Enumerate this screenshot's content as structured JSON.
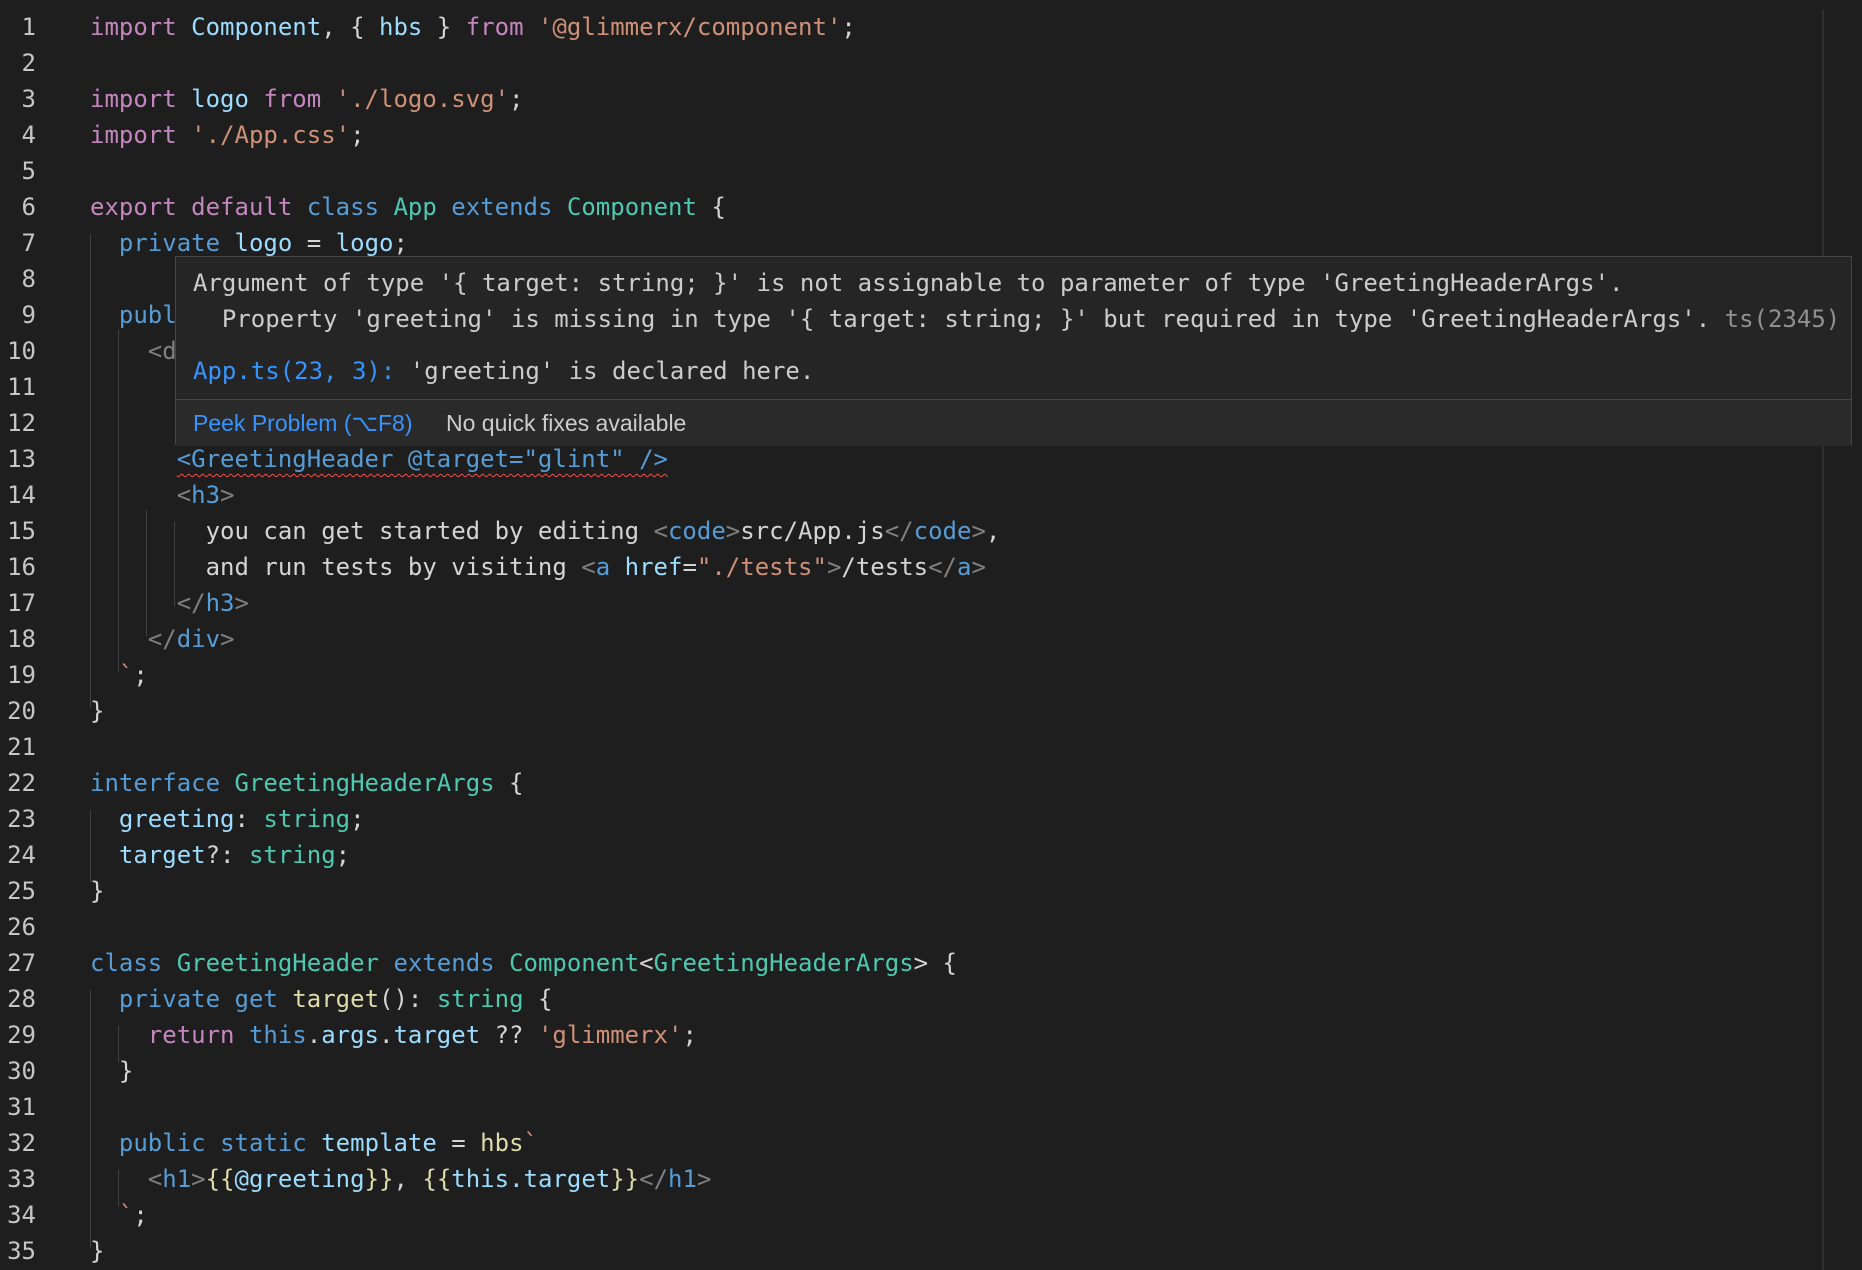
{
  "editor": {
    "line_numbers": [
      "1",
      "2",
      "3",
      "4",
      "5",
      "6",
      "7",
      "8",
      "9",
      "10",
      "11",
      "12",
      "13",
      "14",
      "15",
      "16",
      "17",
      "18",
      "19",
      "20",
      "21",
      "22",
      "23",
      "24",
      "25",
      "26",
      "27",
      "28",
      "29",
      "30",
      "31",
      "32",
      "33",
      "34",
      "35"
    ],
    "lines": [
      [
        [
          "k",
          "import"
        ],
        [
          "p",
          " "
        ],
        [
          "v",
          "Component"
        ],
        [
          "p",
          ", { "
        ],
        [
          "v",
          "hbs"
        ],
        [
          "p",
          " } "
        ],
        [
          "k",
          "from"
        ],
        [
          "p",
          " "
        ],
        [
          "s",
          "'@glimmerx/component'"
        ],
        [
          "p",
          ";"
        ]
      ],
      [],
      [
        [
          "k",
          "import"
        ],
        [
          "p",
          " "
        ],
        [
          "v",
          "logo"
        ],
        [
          "p",
          " "
        ],
        [
          "k",
          "from"
        ],
        [
          "p",
          " "
        ],
        [
          "s",
          "'./logo.svg'"
        ],
        [
          "p",
          ";"
        ]
      ],
      [
        [
          "k",
          "import"
        ],
        [
          "p",
          " "
        ],
        [
          "s",
          "'./App.css'"
        ],
        [
          "p",
          ";"
        ]
      ],
      [],
      [
        [
          "k",
          "export"
        ],
        [
          "p",
          " "
        ],
        [
          "k",
          "default"
        ],
        [
          "p",
          " "
        ],
        [
          "b",
          "class"
        ],
        [
          "p",
          " "
        ],
        [
          "t",
          "App"
        ],
        [
          "p",
          " "
        ],
        [
          "b",
          "extends"
        ],
        [
          "p",
          " "
        ],
        [
          "t",
          "Component"
        ],
        [
          "p",
          " {"
        ]
      ],
      [
        [
          "p",
          "  "
        ],
        [
          "b",
          "private"
        ],
        [
          "p",
          " "
        ],
        [
          "v",
          "logo"
        ],
        [
          "p",
          " = "
        ],
        [
          "v",
          "logo"
        ],
        [
          "p",
          ";"
        ]
      ],
      [],
      [
        [
          "p",
          "  "
        ],
        [
          "b",
          "publ"
        ]
      ],
      [
        [
          "p",
          "    "
        ],
        [
          "g",
          "<d"
        ]
      ],
      [],
      [],
      [
        [
          "p",
          "      "
        ],
        [
          "sq",
          "<GreetingHeader @target=\"glint\" />"
        ]
      ],
      [
        [
          "p",
          "      "
        ],
        [
          "g",
          "<"
        ],
        [
          "b",
          "h3"
        ],
        [
          "g",
          ">"
        ]
      ],
      [
        [
          "p",
          "        you can get started by editing "
        ],
        [
          "g",
          "<"
        ],
        [
          "b",
          "code"
        ],
        [
          "g",
          ">"
        ],
        [
          "p",
          "src/App.js"
        ],
        [
          "g",
          "</"
        ],
        [
          "b",
          "code"
        ],
        [
          "g",
          ">"
        ],
        [
          "p",
          ","
        ]
      ],
      [
        [
          "p",
          "        and run tests by visiting "
        ],
        [
          "g",
          "<"
        ],
        [
          "b",
          "a"
        ],
        [
          "p",
          " "
        ],
        [
          "v",
          "href"
        ],
        [
          "p",
          "="
        ],
        [
          "s",
          "\"./tests\""
        ],
        [
          "g",
          ">"
        ],
        [
          "p",
          "/tests"
        ],
        [
          "g",
          "</"
        ],
        [
          "b",
          "a"
        ],
        [
          "g",
          ">"
        ]
      ],
      [
        [
          "p",
          "      "
        ],
        [
          "g",
          "</"
        ],
        [
          "b",
          "h3"
        ],
        [
          "g",
          ">"
        ]
      ],
      [
        [
          "p",
          "    "
        ],
        [
          "g",
          "</"
        ],
        [
          "b",
          "div"
        ],
        [
          "g",
          ">"
        ]
      ],
      [
        [
          "p",
          "  "
        ],
        [
          "s",
          "`"
        ],
        [
          "p",
          ";"
        ]
      ],
      [
        [
          "p",
          "}"
        ]
      ],
      [],
      [
        [
          "b",
          "interface"
        ],
        [
          "p",
          " "
        ],
        [
          "t",
          "GreetingHeaderArgs"
        ],
        [
          "p",
          " {"
        ]
      ],
      [
        [
          "p",
          "  "
        ],
        [
          "v",
          "greeting"
        ],
        [
          "p",
          ": "
        ],
        [
          "t",
          "string"
        ],
        [
          "p",
          ";"
        ]
      ],
      [
        [
          "p",
          "  "
        ],
        [
          "v",
          "target"
        ],
        [
          "p",
          "?: "
        ],
        [
          "t",
          "string"
        ],
        [
          "p",
          ";"
        ]
      ],
      [
        [
          "p",
          "}"
        ]
      ],
      [],
      [
        [
          "b",
          "class"
        ],
        [
          "p",
          " "
        ],
        [
          "t",
          "GreetingHeader"
        ],
        [
          "p",
          " "
        ],
        [
          "b",
          "extends"
        ],
        [
          "p",
          " "
        ],
        [
          "t",
          "Component"
        ],
        [
          "p",
          "<"
        ],
        [
          "t",
          "GreetingHeaderArgs"
        ],
        [
          "p",
          "> {"
        ]
      ],
      [
        [
          "p",
          "  "
        ],
        [
          "b",
          "private"
        ],
        [
          "p",
          " "
        ],
        [
          "b",
          "get"
        ],
        [
          "p",
          " "
        ],
        [
          "y",
          "target"
        ],
        [
          "p",
          "(): "
        ],
        [
          "t",
          "string"
        ],
        [
          "p",
          " {"
        ]
      ],
      [
        [
          "p",
          "    "
        ],
        [
          "k",
          "return"
        ],
        [
          "p",
          " "
        ],
        [
          "b",
          "this"
        ],
        [
          "p",
          "."
        ],
        [
          "v",
          "args"
        ],
        [
          "p",
          "."
        ],
        [
          "v",
          "target"
        ],
        [
          "p",
          " ?? "
        ],
        [
          "s",
          "'glimmerx'"
        ],
        [
          "p",
          ";"
        ]
      ],
      [
        [
          "p",
          "  }"
        ]
      ],
      [],
      [
        [
          "p",
          "  "
        ],
        [
          "b",
          "public"
        ],
        [
          "p",
          " "
        ],
        [
          "b",
          "static"
        ],
        [
          "p",
          " "
        ],
        [
          "v",
          "template"
        ],
        [
          "p",
          " = "
        ],
        [
          "y",
          "hbs"
        ],
        [
          "s",
          "`"
        ]
      ],
      [
        [
          "p",
          "    "
        ],
        [
          "g",
          "<"
        ],
        [
          "b",
          "h1"
        ],
        [
          "g",
          ">"
        ],
        [
          "y",
          "{{"
        ],
        [
          "v",
          "@greeting"
        ],
        [
          "y",
          "}}"
        ],
        [
          "p",
          ", "
        ],
        [
          "y",
          "{{"
        ],
        [
          "v",
          "this.target"
        ],
        [
          "y",
          "}}"
        ],
        [
          "g",
          "</"
        ],
        [
          "b",
          "h1"
        ],
        [
          "g",
          ">"
        ]
      ],
      [
        [
          "p",
          "  "
        ],
        [
          "s",
          "`"
        ],
        [
          "p",
          ";"
        ]
      ],
      [
        [
          "p",
          "}"
        ]
      ]
    ]
  },
  "hover": {
    "error_line1": "Argument of type '{ target: string; }' is not assignable to parameter of type 'GreetingHeaderArgs'.",
    "error_line2": "  Property 'greeting' is missing in type '{ target: string; }' but required in type 'GreetingHeaderArgs'.",
    "error_code": "ts(2345)",
    "related_link": "App.ts(23, 3):",
    "related_text": "'greeting' is declared here.",
    "peek_label": "Peek Problem (⌥F8)",
    "no_fixes_label": "No quick fixes available"
  },
  "colors": {
    "background": "#1e1e1e",
    "keyword_control": "#c586c0",
    "keyword": "#569cd6",
    "type": "#4ec9b0",
    "variable": "#9cdcfe",
    "string": "#ce9178",
    "function": "#dcdcaa",
    "error_squiggle": "#f14c4c",
    "link": "#3794ff"
  }
}
